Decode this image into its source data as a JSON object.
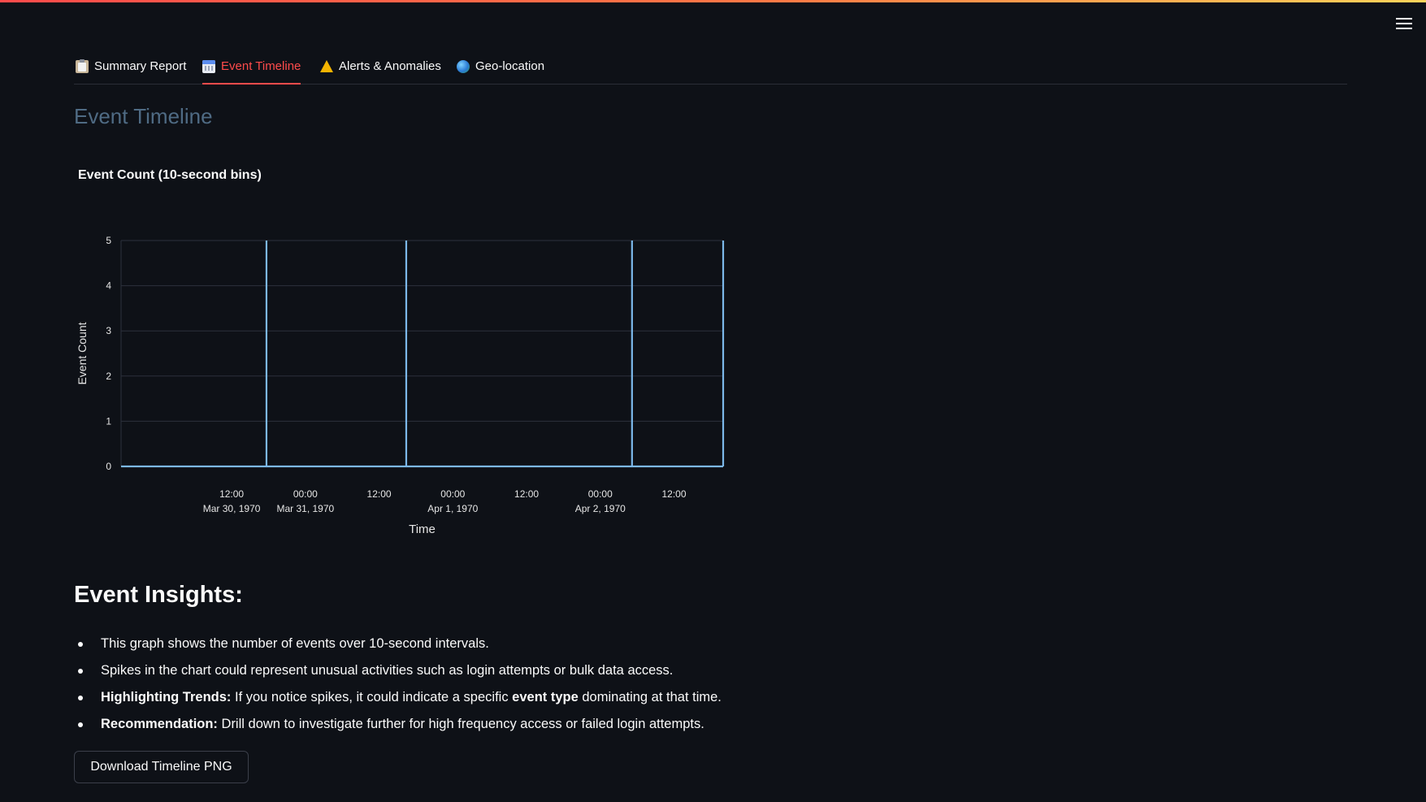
{
  "tabs": [
    {
      "label": "Summary Report",
      "icon": "clipboard-icon"
    },
    {
      "label": "Event Timeline",
      "icon": "calendar-icon"
    },
    {
      "label": "Alerts & Anomalies",
      "icon": "warning-icon"
    },
    {
      "label": "Geo-location",
      "icon": "globe-icon"
    }
  ],
  "active_tab": "Event Timeline",
  "page_title": "Event Timeline",
  "colors": {
    "accent": "#ff4b4b",
    "background": "#0e1117",
    "line": "#7cb8ea",
    "title_muted": "#4f6b84"
  },
  "chart_data": {
    "type": "line",
    "title": "Event Count (10-second bins)",
    "xlabel": "Time",
    "ylabel": "Event Count",
    "ylim": [
      0,
      5
    ],
    "yticks": [
      "0",
      "1",
      "2",
      "3",
      "4",
      "5"
    ],
    "xlim": [
      "1970-03-29T18:00",
      "1970-04-02T20:00"
    ],
    "xticks": [
      {
        "t": "1970-03-30T12:00",
        "line1": "12:00",
        "line2": "Mar 30, 1970"
      },
      {
        "t": "1970-03-31T00:00",
        "line1": "00:00",
        "line2": "Mar 31, 1970"
      },
      {
        "t": "1970-03-31T12:00",
        "line1": "12:00",
        "line2": ""
      },
      {
        "t": "1970-04-01T00:00",
        "line1": "00:00",
        "line2": "Apr 1, 1970"
      },
      {
        "t": "1970-04-01T12:00",
        "line1": "12:00",
        "line2": ""
      },
      {
        "t": "1970-04-02T00:00",
        "line1": "00:00",
        "line2": "Apr 2, 1970"
      },
      {
        "t": "1970-04-02T12:00",
        "line1": "12:00",
        "line2": ""
      }
    ],
    "grid": true,
    "series": [
      {
        "x": [
          "1970-03-29T18:00",
          "1970-03-30T17:40",
          "1970-03-31T16:25",
          "1970-04-02T05:10",
          "1970-04-02T20:00"
        ],
        "y": [
          0,
          5,
          5,
          5,
          5
        ]
      }
    ]
  },
  "insights": {
    "title": "Event Insights:",
    "items": [
      {
        "bold": "",
        "text": "This graph shows the number of events over 10-second intervals."
      },
      {
        "bold": "",
        "text": "Spikes in the chart could represent unusual activities such as login attempts or bulk data access."
      },
      {
        "bold": "Highlighting Trends:",
        "text": " If you notice spikes, it could indicate a specific ",
        "bold2": "event type",
        "text2": " dominating at that time."
      },
      {
        "bold": "Recommendation:",
        "text": " Drill down to investigate further for high frequency access or failed login attempts."
      }
    ]
  },
  "download_label": "Download Timeline PNG"
}
